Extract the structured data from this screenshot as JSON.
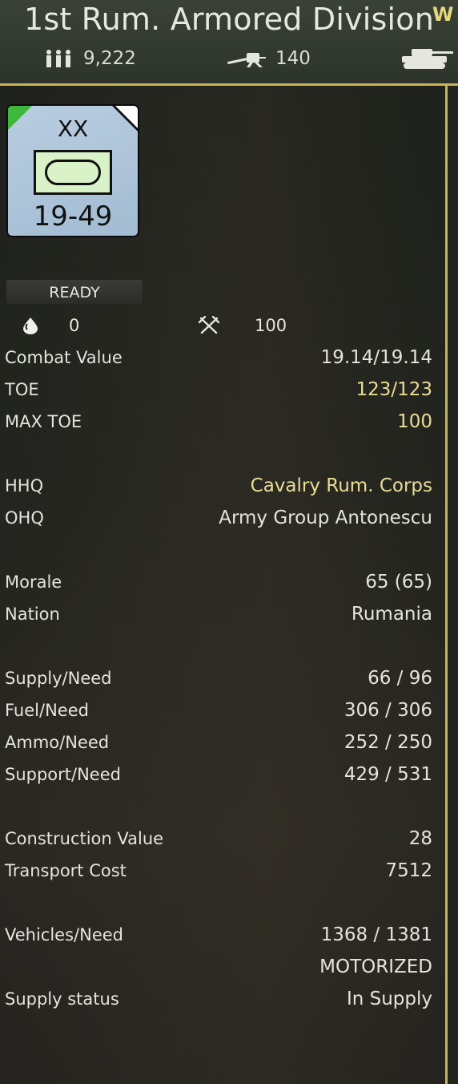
{
  "header": {
    "title": "1st Rum. Armored Division",
    "title_suffix": "W",
    "men": "9,222",
    "guns": "140",
    "tanks": ""
  },
  "counter": {
    "echelon": "XX",
    "strength": "19-49",
    "unit_type_icon": "armor-oval-icon"
  },
  "status": {
    "ready_label": "READY",
    "fatigue": "0",
    "experience": "100"
  },
  "stats": [
    {
      "label": "Combat Value",
      "value": "19.14/19.14",
      "highlight": false
    },
    {
      "label": "TOE",
      "value": "123/123",
      "highlight": true
    },
    {
      "label": "MAX TOE",
      "value": "100",
      "highlight": true
    },
    {
      "label": "HHQ",
      "value": "Cavalry Rum. Corps",
      "highlight": true
    },
    {
      "label": "OHQ",
      "value": "Army Group Antonescu",
      "highlight": false
    },
    {
      "label": "Morale",
      "value": "65 (65)",
      "highlight": false
    },
    {
      "label": "Nation",
      "value": "Rumania",
      "highlight": false
    },
    {
      "label": "Supply/Need",
      "value": "66 / 96",
      "highlight": false
    },
    {
      "label": "Fuel/Need",
      "value": "306 / 306",
      "highlight": false
    },
    {
      "label": "Ammo/Need",
      "value": "252 / 250",
      "highlight": false
    },
    {
      "label": "Support/Need",
      "value": "429 / 531",
      "highlight": false
    },
    {
      "label": "Construction Value",
      "value": "28",
      "highlight": false
    },
    {
      "label": "Transport Cost",
      "value": "7512",
      "highlight": false
    },
    {
      "label": "Vehicles/Need",
      "value": "1368 / 1381",
      "highlight": false
    },
    {
      "label": "",
      "value": "MOTORIZED",
      "highlight": false
    },
    {
      "label": "Supply status",
      "value": "In Supply",
      "highlight": false
    }
  ],
  "colors": {
    "accent_border": "#c8b35a",
    "highlight_text": "#e8dd96",
    "counter_fill": "#a3bcd3",
    "counter_symbol_fill": "#d9f2c8"
  }
}
